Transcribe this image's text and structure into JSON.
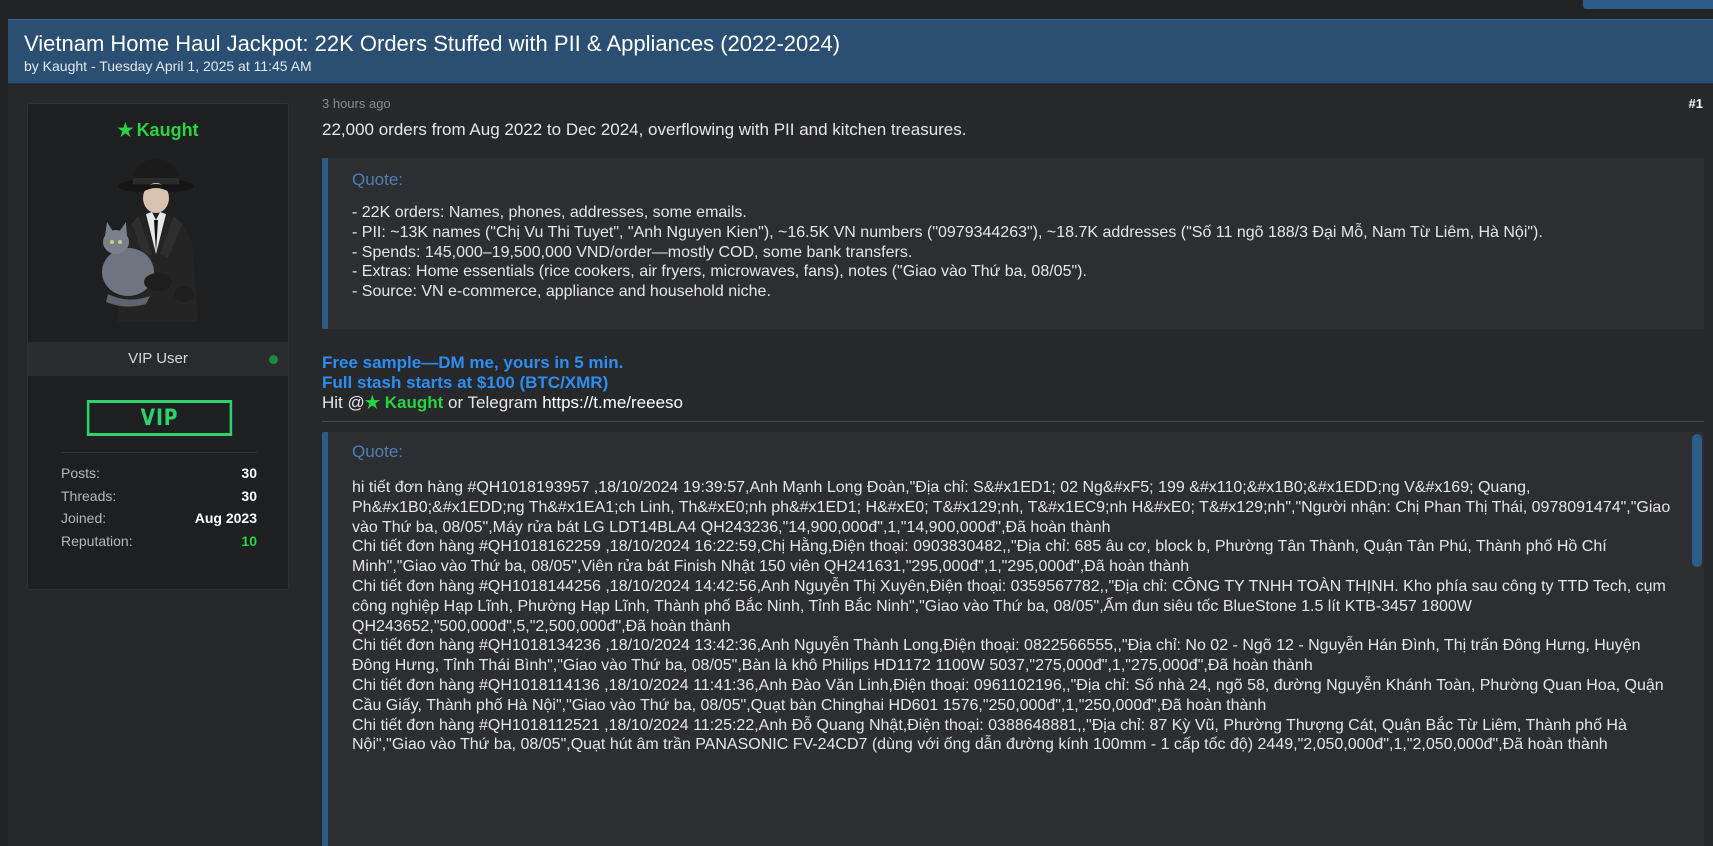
{
  "thread": {
    "title": "Vietnam Home Haul Jackpot: 22K Orders Stuffed with PII & Appliances (2022-2024)",
    "meta": "by Kaught - Tuesday April 1, 2025 at 11:45 AM"
  },
  "user": {
    "star": "★",
    "name": "Kaught",
    "title": "VIP User",
    "badge": "VIP",
    "stats": [
      {
        "key": "Posts:",
        "value": "30"
      },
      {
        "key": "Threads:",
        "value": "30"
      },
      {
        "key": "Joined:",
        "value": "Aug 2023"
      },
      {
        "key": "Reputation:",
        "value": "10"
      }
    ]
  },
  "post": {
    "time": "3 hours ago",
    "number": "#1",
    "intro": "22,000 orders from Aug 2022 to Dec 2024, overflowing with PII and kitchen treasures.",
    "quote_label": "Quote:",
    "quote1_lines": [
      "- 22K orders: Names, phones, addresses, some emails.",
      "- PII: ~13K names (\"Chị Vu Thi Tuyet\", \"Anh Nguyen Kien\"), ~16.5K VN numbers (\"0979344263\"), ~18.7K addresses (\"Số 11 ngõ 188/3 Đại Mỗ, Nam Từ Liêm, Hà Nội\").",
      "- Spends: 145,000–19,500,000 VND/order—mostly COD, some bank transfers.",
      "- Extras: Home essentials (rice cookers, air fryers, microwaves, fans), notes (\"Giao vào Thứ ba, 08/05\").",
      "- Source: VN e-commerce, appliance and household niche."
    ],
    "cta_line1": "Free sample—DM me, yours in 5 min.",
    "cta_line2": "Full stash starts at $100 (BTC/XMR)",
    "hit_prefix": "Hit @",
    "hit_star": "★",
    "hit_name": "Kaught",
    "hit_middle": " or Telegram ",
    "hit_url": "https://t.me/reeeso",
    "quote2_entries": [
      "hi tiết đơn hàng #QH1018193957 ,18/10/2024 19:39:57,Anh Mạnh Long Đoàn,\"Địa chỉ: S&#x1ED1; 02 Ng&#xF5; 199 &#x110;&#x1B0;&#x1EDD;ng V&#x169; Quang, Ph&#x1B0;&#x1EDD;ng Th&#x1EA1;ch Linh, Th&#xE0;nh ph&#x1ED1; H&#xE0; T&#x129;nh, T&#x1EC9;nh H&#xE0; T&#x129;nh\",\"Người nhận: Chị Phan Thị Thái, 0978091474\",\"Giao vào Thứ ba, 08/05\",Máy rửa bát LG LDT14BLA4 QH243236,\"14,900,000đ\",1,\"14,900,000đ\",Đã hoàn thành",
      "Chi tiết đơn hàng #QH1018162259 ,18/10/2024 16:22:59,Chị Hằng,Điện thoại: 0903830482,,\"Địa chỉ: 685 âu cơ, block b, Phường Tân Thành, Quận Tân Phú, Thành phố Hồ Chí Minh\",\"Giao vào Thứ ba, 08/05\",Viên rửa bát Finish Nhật 150 viên QH241631,\"295,000đ\",1,\"295,000đ\",Đã hoàn thành",
      "Chi tiết đơn hàng #QH1018144256 ,18/10/2024 14:42:56,Anh Nguyễn Thị Xuyên,Điện thoại: 0359567782,,\"Địa chỉ: CÔNG TY TNHH TOÀN THỊNH. Kho phía sau công ty TTD Tech, cụm công nghiệp Hạp Lĩnh, Phường Hạp Lĩnh, Thành phố Bắc Ninh, Tỉnh Bắc Ninh\",\"Giao vào Thứ ba, 08/05\",Ấm đun siêu tốc BlueStone 1.5 lít KTB-3457 1800W QH243652,\"500,000đ\",5,\"2,500,000đ\",Đã hoàn thành",
      "Chi tiết đơn hàng #QH1018134236 ,18/10/2024 13:42:36,Anh Nguyễn Thành Long,Điện thoại: 0822566555,,\"Địa chỉ: No 02 - Ngõ 12 - Nguyễn Hán Đình, Thị trấn Đông Hưng, Huyện Đông Hưng, Tỉnh Thái Bình\",\"Giao vào Thứ ba, 08/05\",Bàn là khô Philips HD1172 1100W 5037,\"275,000đ\",1,\"275,000đ\",Đã hoàn thành",
      "Chi tiết đơn hàng #QH1018114136 ,18/10/2024 11:41:36,Anh Đào Văn Linh,Điện thoại: 0961102196,,\"Địa chỉ: Số nhà 24, ngõ 58, đường Nguyễn Khánh Toàn, Phường Quan Hoa, Quận Cầu Giấy, Thành phố Hà Nội\",\"Giao vào Thứ ba, 08/05\",Quạt bàn Chinghai HD601 1576,\"250,000đ\",1,\"250,000đ\",Đã hoàn thành",
      "Chi tiết đơn hàng #QH1018112521 ,18/10/2024 11:25:22,Anh Đỗ Quang Nhật,Điện thoại: 0388648881,,\"Địa chỉ: 87 Kỳ Vũ, Phường Thượng Cát, Quận Bắc Từ Liêm, Thành phố Hà Nội\",\"Giao vào Thứ ba, 08/05\",Quạt hút âm trần PANASONIC FV-24CD7 (dùng với ống dẫn đường kính 100mm - 1 cấp tốc độ) 2449,\"2,050,000đ\",1,\"2,050,000đ\",Đã hoàn thành"
    ]
  },
  "colors": {
    "header": "#2b4f72",
    "accent": "#2e5c88",
    "green": "#29d341",
    "link_blue": "#2e8ef0"
  }
}
